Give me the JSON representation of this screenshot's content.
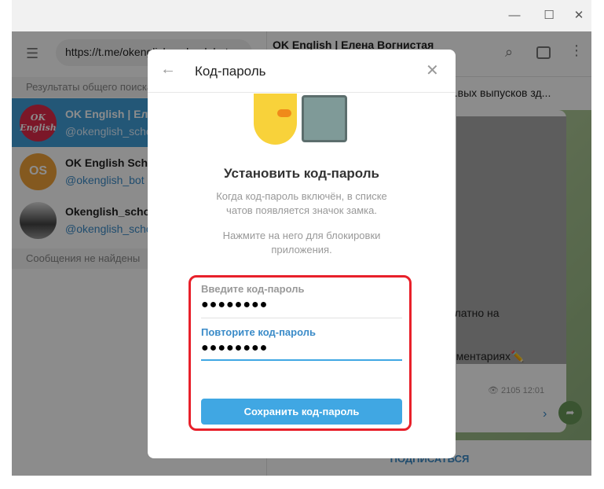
{
  "window": {
    "minimize": "—",
    "maximize": "☐",
    "close": "✕"
  },
  "search": {
    "value": "https://t.me/okenglish_school_bot"
  },
  "left": {
    "section_global": "Результаты общего поиска",
    "results": [
      {
        "name": "OK English | Елена Вогнистая",
        "username": "@okenglish_school",
        "avatar": "OK English",
        "avatar_color": "#e02a4a",
        "selected": true
      },
      {
        "name": "OK English School",
        "username": "@okenglish_bot",
        "avatar": "OS",
        "avatar_color": "#f0a23a",
        "selected": false
      },
      {
        "name": "Okenglish_school",
        "username": "@okenglish_school",
        "avatar": "",
        "avatar_color": "#444444",
        "selected": false
      }
    ],
    "section_messages": "Сообщения не найдены"
  },
  "chat": {
    "title": "OK English | Елена Вогнистая",
    "pinned": "...вых выпусков зд...",
    "msg_line1": "платно на",
    "msg_line2": "мментариях✏️",
    "views": "2105",
    "time": "12:01",
    "subscribe": "ПОДПИСАТЬСЯ"
  },
  "dialog": {
    "title": "Код-пароль",
    "heading": "Установить код-пароль",
    "desc1": "Когда код-пароль включён, в списке чатов появляется значок замка.",
    "desc2": "Нажмите на него для блокировки приложения.",
    "field1_label": "Введите код-пароль",
    "field1_value": "●●●●●●●●",
    "field2_label": "Повторите код-пароль",
    "field2_value": "●●●●●●●●",
    "save": "Сохранить код-пароль"
  },
  "colors": {
    "accent": "#40a7e3",
    "highlight": "#e8202a"
  }
}
